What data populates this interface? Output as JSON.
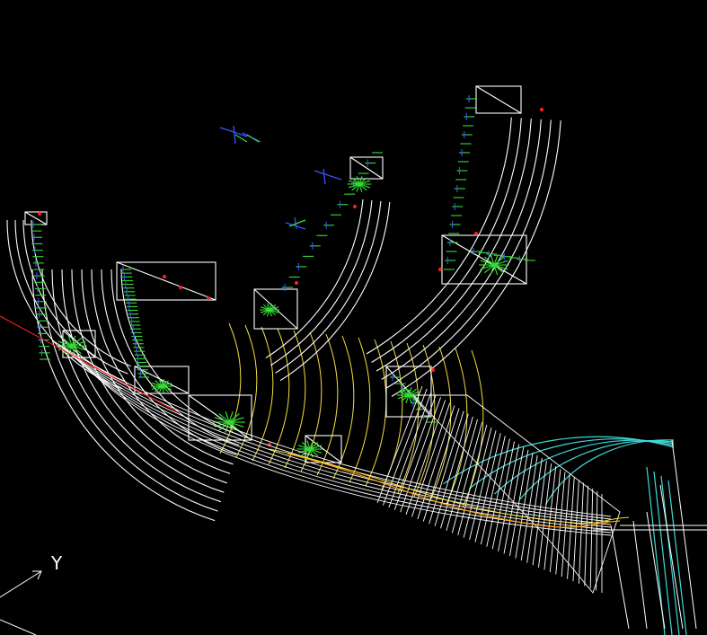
{
  "viewport": {
    "background": "#000000",
    "axis_labels": {
      "y": "Y"
    },
    "colors": {
      "geometry": "#ffffff",
      "field_lines": "#f0e040",
      "field_lines_far": "#40d8d8",
      "hits_green": "#33dd33",
      "hits_blue": "#3355ff",
      "track_red": "#ff2020",
      "track_orange": "#ff9900"
    }
  }
}
